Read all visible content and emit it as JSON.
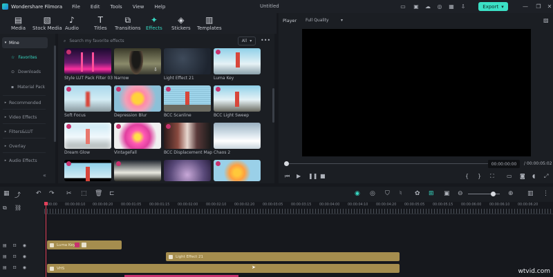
{
  "app": {
    "name": "Wondershare Filmora",
    "doc_title": "Untitled",
    "export_label": "Export"
  },
  "menu": [
    "File",
    "Edit",
    "Tools",
    "View",
    "Help"
  ],
  "toolbar": {
    "tabs": [
      "Media",
      "Stock Media",
      "Audio",
      "Titles",
      "Transitions",
      "Effects",
      "Stickers",
      "Templates"
    ],
    "active": "Effects"
  },
  "sidebar": {
    "mine": "Mine",
    "favorites": "Favorites",
    "downloads": "Downloads",
    "material_pack": "Material Pack",
    "recommended": "Recommended",
    "video_effects": "Video Effects",
    "filters_lut": "Filters&LUT",
    "overlay": "Overlay",
    "audio_effects": "Audio Effects"
  },
  "effects": {
    "search_placeholder": "Search my favorite effects",
    "filter_value": "All",
    "items": [
      "Style LUT Pack Filter 03",
      "Narrow",
      "Light Effect 21",
      "Luma Key",
      "Soft Focus",
      "Depression Blur",
      "BCC Scanline",
      "BCC Light Sweep",
      "Dream Glow",
      "VintageFall",
      "BCC Displacement Map",
      "Chaos 2"
    ]
  },
  "player": {
    "label": "Player",
    "quality": "Full Quality",
    "current_time": "00:00:00:00",
    "total_time": "/ 00:00:05:02"
  },
  "timeline": {
    "ruler": [
      "00:00",
      "00:00:00:10",
      "00:00:00:20",
      "00:00:01:05",
      "00:00:01:15",
      "00:00:02:00",
      "00:00:02:10",
      "00:00:02:20",
      "00:00:03:05",
      "00:00:03:15",
      "00:00:04:00",
      "00:00:04:10",
      "00:00:04:20",
      "00:00:05:05",
      "00:00:05:15",
      "00:00:06:00",
      "00:00:06:10",
      "00:00:06:20",
      "00:00:07:05"
    ],
    "clips": {
      "clip1": "Luma Key",
      "clip2": "Light Effect 21",
      "clip3": "VHS"
    }
  },
  "watermark": "wtvid.com",
  "colors": {
    "accent": "#37d9c3",
    "export": "#3be0c5",
    "clip": "#a58d4e",
    "playhead": "#e2405a"
  }
}
